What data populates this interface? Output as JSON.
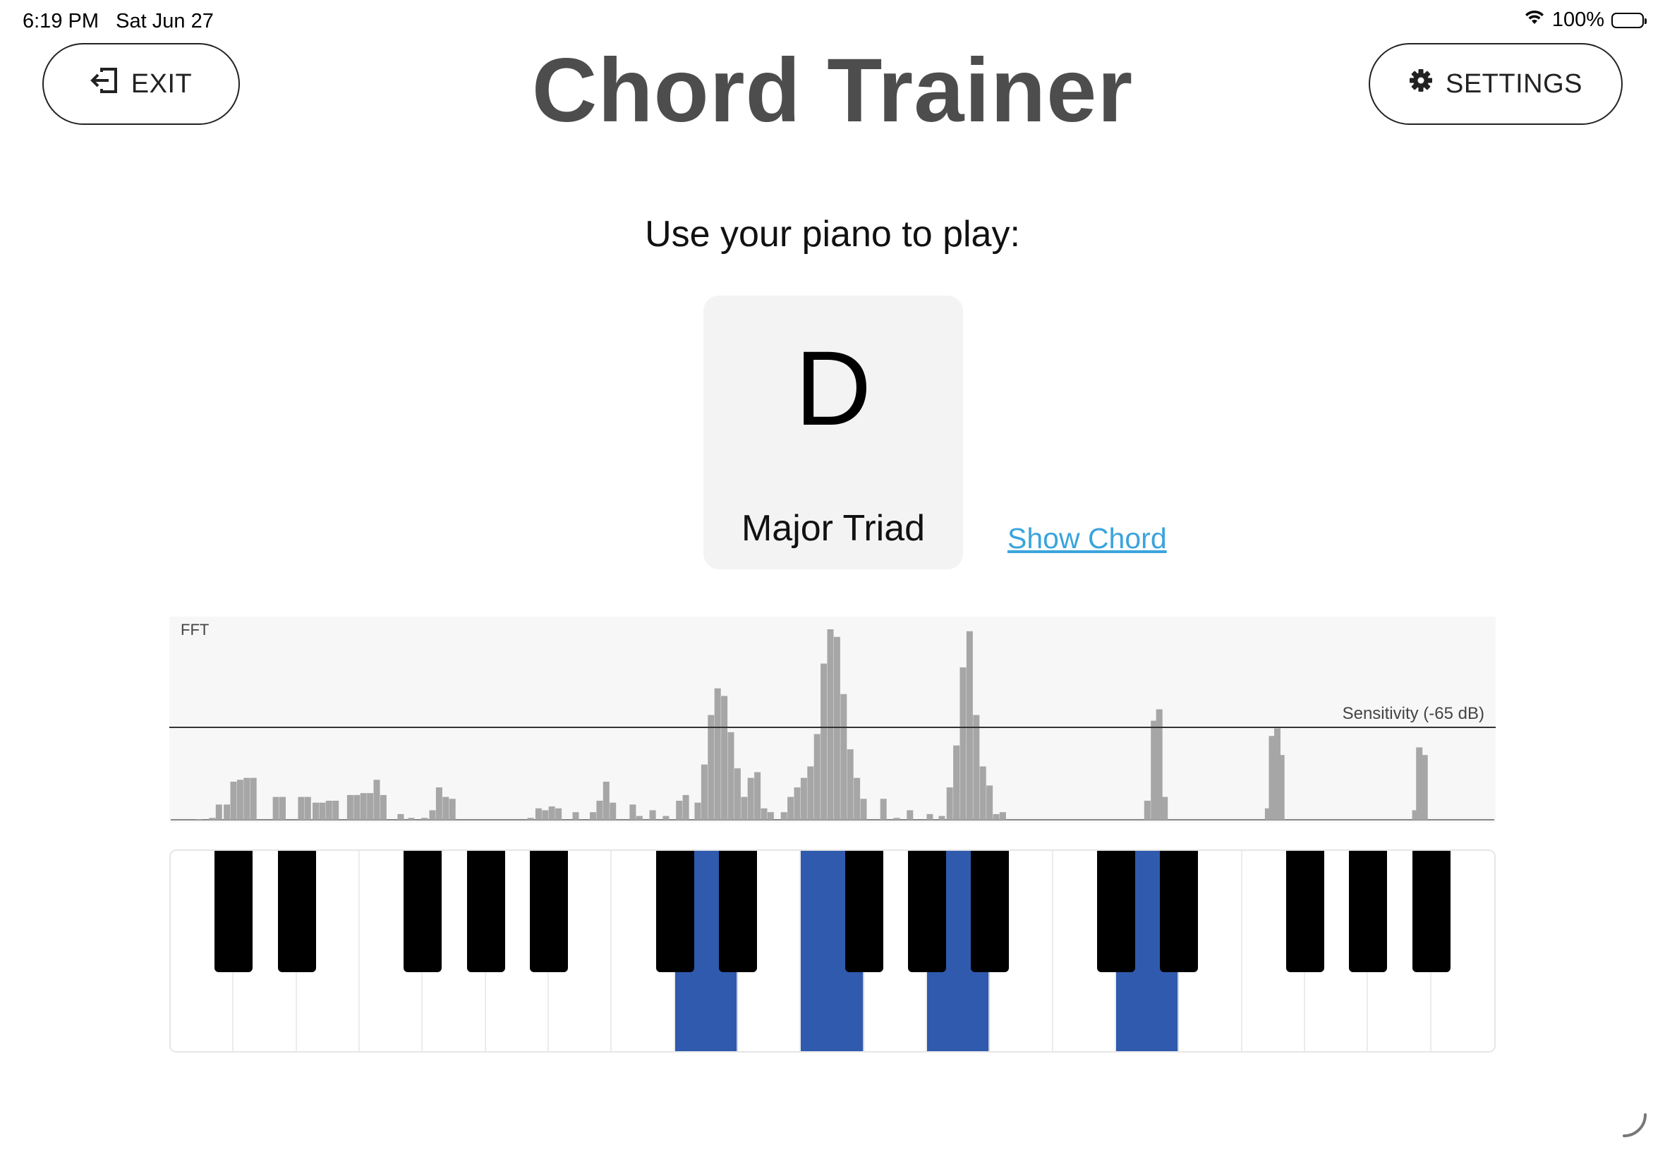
{
  "status": {
    "time": "6:19 PM",
    "date": "Sat Jun 27",
    "battery": "100%",
    "wifi_icon": "wifi-icon",
    "battery_icon": "battery-icon"
  },
  "header": {
    "exit_label": "EXIT",
    "exit_icon": "exit-icon",
    "title": "Chord Trainer",
    "settings_label": "SETTINGS",
    "settings_icon": "gear-icon"
  },
  "exercise": {
    "prompt": "Use your piano to play:",
    "chord_root": "D",
    "chord_quality": "Major Triad",
    "show_chord_label": "Show Chord"
  },
  "fft": {
    "label": "FFT",
    "sensitivity_label": "Sensitivity (-65 dB)",
    "sensitivity_db": -65,
    "bar_color": "#a6a6a6",
    "spectrum": [
      {
        "pos": 0.02,
        "h": 0.0
      },
      {
        "pos": 0.03,
        "h": 0.01
      },
      {
        "pos": 0.035,
        "h": 0.08
      },
      {
        "pos": 0.041,
        "h": 0.08
      },
      {
        "pos": 0.046,
        "h": 0.2
      },
      {
        "pos": 0.051,
        "h": 0.21
      },
      {
        "pos": 0.056,
        "h": 0.22
      },
      {
        "pos": 0.061,
        "h": 0.22
      },
      {
        "pos": 0.078,
        "h": 0.12
      },
      {
        "pos": 0.083,
        "h": 0.12
      },
      {
        "pos": 0.097,
        "h": 0.12
      },
      {
        "pos": 0.102,
        "h": 0.12
      },
      {
        "pos": 0.108,
        "h": 0.09
      },
      {
        "pos": 0.113,
        "h": 0.09
      },
      {
        "pos": 0.118,
        "h": 0.1
      },
      {
        "pos": 0.123,
        "h": 0.1
      },
      {
        "pos": 0.134,
        "h": 0.13
      },
      {
        "pos": 0.139,
        "h": 0.13
      },
      {
        "pos": 0.144,
        "h": 0.14
      },
      {
        "pos": 0.149,
        "h": 0.14
      },
      {
        "pos": 0.154,
        "h": 0.21
      },
      {
        "pos": 0.159,
        "h": 0.13
      },
      {
        "pos": 0.172,
        "h": 0.03
      },
      {
        "pos": 0.18,
        "h": 0.01
      },
      {
        "pos": 0.19,
        "h": 0.01
      },
      {
        "pos": 0.196,
        "h": 0.05
      },
      {
        "pos": 0.201,
        "h": 0.17
      },
      {
        "pos": 0.206,
        "h": 0.12
      },
      {
        "pos": 0.211,
        "h": 0.11
      },
      {
        "pos": 0.27,
        "h": 0.01
      },
      {
        "pos": 0.276,
        "h": 0.06
      },
      {
        "pos": 0.281,
        "h": 0.05
      },
      {
        "pos": 0.286,
        "h": 0.07
      },
      {
        "pos": 0.291,
        "h": 0.06
      },
      {
        "pos": 0.304,
        "h": 0.04
      },
      {
        "pos": 0.317,
        "h": 0.04
      },
      {
        "pos": 0.322,
        "h": 0.1
      },
      {
        "pos": 0.327,
        "h": 0.2
      },
      {
        "pos": 0.332,
        "h": 0.09
      },
      {
        "pos": 0.347,
        "h": 0.08
      },
      {
        "pos": 0.352,
        "h": 0.02
      },
      {
        "pos": 0.362,
        "h": 0.05
      },
      {
        "pos": 0.372,
        "h": 0.02
      },
      {
        "pos": 0.382,
        "h": 0.1
      },
      {
        "pos": 0.387,
        "h": 0.13
      },
      {
        "pos": 0.396,
        "h": 0.09
      },
      {
        "pos": 0.401,
        "h": 0.29
      },
      {
        "pos": 0.406,
        "h": 0.55
      },
      {
        "pos": 0.411,
        "h": 0.69
      },
      {
        "pos": 0.416,
        "h": 0.65
      },
      {
        "pos": 0.421,
        "h": 0.46
      },
      {
        "pos": 0.426,
        "h": 0.27
      },
      {
        "pos": 0.431,
        "h": 0.12
      },
      {
        "pos": 0.436,
        "h": 0.22
      },
      {
        "pos": 0.441,
        "h": 0.25
      },
      {
        "pos": 0.446,
        "h": 0.06
      },
      {
        "pos": 0.451,
        "h": 0.04
      },
      {
        "pos": 0.461,
        "h": 0.04
      },
      {
        "pos": 0.466,
        "h": 0.12
      },
      {
        "pos": 0.471,
        "h": 0.17
      },
      {
        "pos": 0.476,
        "h": 0.22
      },
      {
        "pos": 0.481,
        "h": 0.28
      },
      {
        "pos": 0.486,
        "h": 0.45
      },
      {
        "pos": 0.491,
        "h": 0.82
      },
      {
        "pos": 0.496,
        "h": 1.0
      },
      {
        "pos": 0.501,
        "h": 0.96
      },
      {
        "pos": 0.506,
        "h": 0.66
      },
      {
        "pos": 0.511,
        "h": 0.37
      },
      {
        "pos": 0.516,
        "h": 0.22
      },
      {
        "pos": 0.521,
        "h": 0.11
      },
      {
        "pos": 0.536,
        "h": 0.11
      },
      {
        "pos": 0.546,
        "h": 0.01
      },
      {
        "pos": 0.556,
        "h": 0.05
      },
      {
        "pos": 0.571,
        "h": 0.03
      },
      {
        "pos": 0.58,
        "h": 0.02
      },
      {
        "pos": 0.586,
        "h": 0.17
      },
      {
        "pos": 0.591,
        "h": 0.39
      },
      {
        "pos": 0.596,
        "h": 0.8
      },
      {
        "pos": 0.601,
        "h": 0.99
      },
      {
        "pos": 0.606,
        "h": 0.55
      },
      {
        "pos": 0.611,
        "h": 0.28
      },
      {
        "pos": 0.616,
        "h": 0.18
      },
      {
        "pos": 0.621,
        "h": 0.03
      },
      {
        "pos": 0.626,
        "h": 0.04
      },
      {
        "pos": 0.735,
        "h": 0.1
      },
      {
        "pos": 0.74,
        "h": 0.52
      },
      {
        "pos": 0.744,
        "h": 0.58
      },
      {
        "pos": 0.748,
        "h": 0.12
      },
      {
        "pos": 0.826,
        "h": 0.06
      },
      {
        "pos": 0.829,
        "h": 0.44
      },
      {
        "pos": 0.833,
        "h": 0.48
      },
      {
        "pos": 0.836,
        "h": 0.34
      },
      {
        "pos": 0.937,
        "h": 0.05
      },
      {
        "pos": 0.94,
        "h": 0.38
      },
      {
        "pos": 0.944,
        "h": 0.34
      }
    ]
  },
  "keyboard": {
    "white_key_count": 21,
    "active_white_keys": [
      8,
      10,
      12,
      15
    ],
    "black_key_slots": [
      0,
      1,
      3,
      4,
      5,
      7,
      8,
      10,
      11,
      12,
      14,
      15,
      17,
      18,
      19
    ],
    "active_black_keys": [],
    "active_color": "#2f5aad"
  },
  "loading_icon": "spinner-icon"
}
